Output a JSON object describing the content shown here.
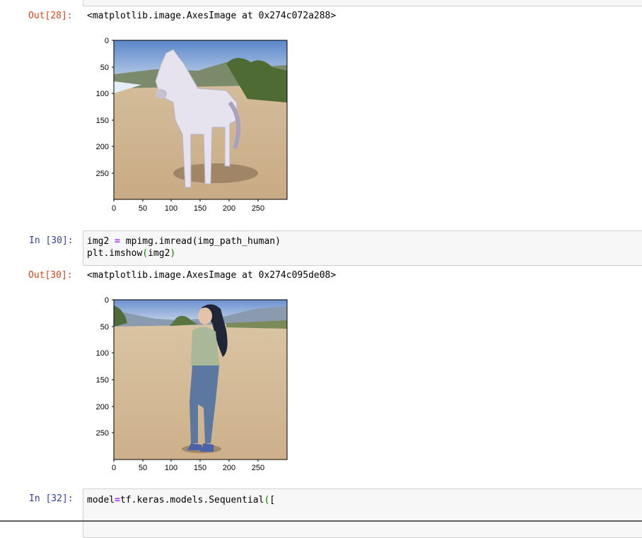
{
  "cells": [
    {
      "out_prompt": "Out[28]:",
      "out_text": "<matplotlib.image.AxesImage at 0x274c072a288>",
      "image_subject": "horse on a sandy beach",
      "yticks": [
        "0",
        "50",
        "100",
        "150",
        "200",
        "250"
      ],
      "xticks": [
        "0",
        "50",
        "100",
        "150",
        "200",
        "250"
      ]
    },
    {
      "in_prompt": "In [30]:",
      "code": [
        {
          "a": "img2 ",
          "op": "=",
          "b": " mpimg.imread(img_path_human)"
        },
        {
          "a": "plt.imshow",
          "paren_open": "(",
          "b": "img2",
          "paren_close": ")"
        }
      ],
      "out_prompt": "Out[30]:",
      "out_text": "<matplotlib.image.AxesImage at 0x274c095de08>",
      "image_subject": "woman standing on a sandy beach",
      "yticks": [
        "0",
        "50",
        "100",
        "150",
        "200",
        "250"
      ],
      "xticks": [
        "0",
        "50",
        "100",
        "150",
        "200",
        "250"
      ]
    },
    {
      "in_prompt": "In [32]:",
      "code": [
        {
          "a": "model",
          "op": "=",
          "b": "tf.keras.models.Sequential",
          "paren_open": "(",
          "rest": "["
        }
      ]
    }
  ],
  "colors": {
    "in_prompt": "#303f9f",
    "out_prompt": "#d84315",
    "operator": "#aa22ff",
    "paren": "#008000",
    "cell_bg": "#f7f7f7"
  }
}
